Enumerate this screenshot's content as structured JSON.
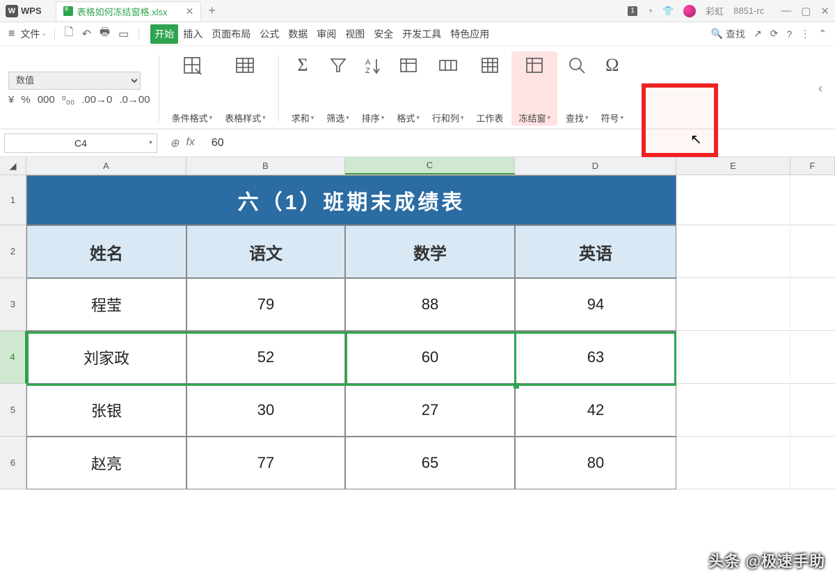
{
  "app": {
    "name": "WPS"
  },
  "tab": {
    "filename": "表格如何冻结窗格.xlsx"
  },
  "titlebar": {
    "badge": "1",
    "user": "彩虹",
    "build": "8851-rc"
  },
  "menu": {
    "file": "文件",
    "tabs": [
      "开始",
      "插入",
      "页面布局",
      "公式",
      "数据",
      "审阅",
      "视图",
      "安全",
      "开发工具",
      "特色应用"
    ],
    "active_index": 0,
    "search": "查找"
  },
  "ribbon": {
    "numfmt": "数值",
    "numfmt_icons": [
      "¥",
      "%",
      "000",
      "⁰₀₀",
      ".00→0",
      ".0→00"
    ],
    "groups": [
      {
        "label": "条件格式",
        "icon": "cond-format"
      },
      {
        "label": "表格样式",
        "icon": "table-style"
      },
      {
        "label": "求和",
        "icon": "sum"
      },
      {
        "label": "筛选",
        "icon": "filter"
      },
      {
        "label": "排序",
        "icon": "sort"
      },
      {
        "label": "格式",
        "icon": "format"
      },
      {
        "label": "行和列",
        "icon": "rowcol"
      },
      {
        "label": "工作表",
        "icon": "sheet"
      },
      {
        "label": "冻结窗",
        "icon": "freeze"
      },
      {
        "label": "查找",
        "icon": "find"
      },
      {
        "label": "符号",
        "icon": "symbol"
      }
    ]
  },
  "fx": {
    "cell": "C4",
    "value": "60"
  },
  "cols": [
    "A",
    "B",
    "C",
    "D",
    "E",
    "F"
  ],
  "active_col_index": 2,
  "rows": [
    "1",
    "2",
    "3",
    "4",
    "5",
    "6"
  ],
  "active_row_index": 3,
  "sheet": {
    "title": "六（1）班期末成绩表",
    "headers": [
      "姓名",
      "语文",
      "数学",
      "英语"
    ],
    "data": [
      [
        "程莹",
        "79",
        "88",
        "94"
      ],
      [
        "刘家政",
        "52",
        "60",
        "63"
      ],
      [
        "张银",
        "30",
        "27",
        "42"
      ],
      [
        "赵亮",
        "77",
        "65",
        "80"
      ]
    ]
  },
  "watermark": "头条 @极速手助"
}
